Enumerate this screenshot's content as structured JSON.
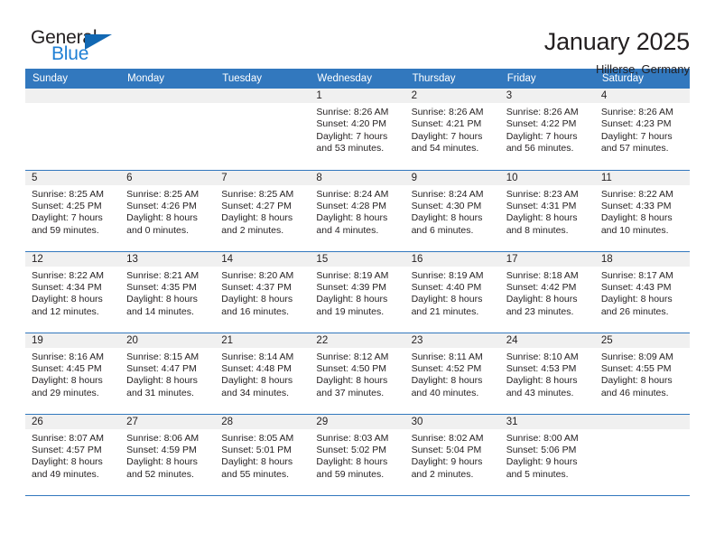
{
  "logo": {
    "word1": "General",
    "word2": "Blue",
    "triangle_color": "#1268b3",
    "blue_color": "#1f7fd4"
  },
  "header": {
    "title": "January 2025",
    "subtitle": "Hillerse, Germany"
  },
  "theme": {
    "header_blue": "#3278be",
    "daynum_band": "#f0f0f0",
    "text": "#231f20"
  },
  "weekdays": [
    "Sunday",
    "Monday",
    "Tuesday",
    "Wednesday",
    "Thursday",
    "Friday",
    "Saturday"
  ],
  "labels": {
    "sunrise_prefix": "Sunrise:",
    "sunset_prefix": "Sunset:",
    "daylight_prefix": "Daylight:"
  },
  "weeks": [
    [
      {
        "day": "",
        "empty": true
      },
      {
        "day": "",
        "empty": true
      },
      {
        "day": "",
        "empty": true
      },
      {
        "day": "1",
        "sunrise": "Sunrise: 8:26 AM",
        "sunset": "Sunset: 4:20 PM",
        "daylight1": "Daylight: 7 hours",
        "daylight2": "and 53 minutes."
      },
      {
        "day": "2",
        "sunrise": "Sunrise: 8:26 AM",
        "sunset": "Sunset: 4:21 PM",
        "daylight1": "Daylight: 7 hours",
        "daylight2": "and 54 minutes."
      },
      {
        "day": "3",
        "sunrise": "Sunrise: 8:26 AM",
        "sunset": "Sunset: 4:22 PM",
        "daylight1": "Daylight: 7 hours",
        "daylight2": "and 56 minutes."
      },
      {
        "day": "4",
        "sunrise": "Sunrise: 8:26 AM",
        "sunset": "Sunset: 4:23 PM",
        "daylight1": "Daylight: 7 hours",
        "daylight2": "and 57 minutes."
      }
    ],
    [
      {
        "day": "5",
        "sunrise": "Sunrise: 8:25 AM",
        "sunset": "Sunset: 4:25 PM",
        "daylight1": "Daylight: 7 hours",
        "daylight2": "and 59 minutes."
      },
      {
        "day": "6",
        "sunrise": "Sunrise: 8:25 AM",
        "sunset": "Sunset: 4:26 PM",
        "daylight1": "Daylight: 8 hours",
        "daylight2": "and 0 minutes."
      },
      {
        "day": "7",
        "sunrise": "Sunrise: 8:25 AM",
        "sunset": "Sunset: 4:27 PM",
        "daylight1": "Daylight: 8 hours",
        "daylight2": "and 2 minutes."
      },
      {
        "day": "8",
        "sunrise": "Sunrise: 8:24 AM",
        "sunset": "Sunset: 4:28 PM",
        "daylight1": "Daylight: 8 hours",
        "daylight2": "and 4 minutes."
      },
      {
        "day": "9",
        "sunrise": "Sunrise: 8:24 AM",
        "sunset": "Sunset: 4:30 PM",
        "daylight1": "Daylight: 8 hours",
        "daylight2": "and 6 minutes."
      },
      {
        "day": "10",
        "sunrise": "Sunrise: 8:23 AM",
        "sunset": "Sunset: 4:31 PM",
        "daylight1": "Daylight: 8 hours",
        "daylight2": "and 8 minutes."
      },
      {
        "day": "11",
        "sunrise": "Sunrise: 8:22 AM",
        "sunset": "Sunset: 4:33 PM",
        "daylight1": "Daylight: 8 hours",
        "daylight2": "and 10 minutes."
      }
    ],
    [
      {
        "day": "12",
        "sunrise": "Sunrise: 8:22 AM",
        "sunset": "Sunset: 4:34 PM",
        "daylight1": "Daylight: 8 hours",
        "daylight2": "and 12 minutes."
      },
      {
        "day": "13",
        "sunrise": "Sunrise: 8:21 AM",
        "sunset": "Sunset: 4:35 PM",
        "daylight1": "Daylight: 8 hours",
        "daylight2": "and 14 minutes."
      },
      {
        "day": "14",
        "sunrise": "Sunrise: 8:20 AM",
        "sunset": "Sunset: 4:37 PM",
        "daylight1": "Daylight: 8 hours",
        "daylight2": "and 16 minutes."
      },
      {
        "day": "15",
        "sunrise": "Sunrise: 8:19 AM",
        "sunset": "Sunset: 4:39 PM",
        "daylight1": "Daylight: 8 hours",
        "daylight2": "and 19 minutes."
      },
      {
        "day": "16",
        "sunrise": "Sunrise: 8:19 AM",
        "sunset": "Sunset: 4:40 PM",
        "daylight1": "Daylight: 8 hours",
        "daylight2": "and 21 minutes."
      },
      {
        "day": "17",
        "sunrise": "Sunrise: 8:18 AM",
        "sunset": "Sunset: 4:42 PM",
        "daylight1": "Daylight: 8 hours",
        "daylight2": "and 23 minutes."
      },
      {
        "day": "18",
        "sunrise": "Sunrise: 8:17 AM",
        "sunset": "Sunset: 4:43 PM",
        "daylight1": "Daylight: 8 hours",
        "daylight2": "and 26 minutes."
      }
    ],
    [
      {
        "day": "19",
        "sunrise": "Sunrise: 8:16 AM",
        "sunset": "Sunset: 4:45 PM",
        "daylight1": "Daylight: 8 hours",
        "daylight2": "and 29 minutes."
      },
      {
        "day": "20",
        "sunrise": "Sunrise: 8:15 AM",
        "sunset": "Sunset: 4:47 PM",
        "daylight1": "Daylight: 8 hours",
        "daylight2": "and 31 minutes."
      },
      {
        "day": "21",
        "sunrise": "Sunrise: 8:14 AM",
        "sunset": "Sunset: 4:48 PM",
        "daylight1": "Daylight: 8 hours",
        "daylight2": "and 34 minutes."
      },
      {
        "day": "22",
        "sunrise": "Sunrise: 8:12 AM",
        "sunset": "Sunset: 4:50 PM",
        "daylight1": "Daylight: 8 hours",
        "daylight2": "and 37 minutes."
      },
      {
        "day": "23",
        "sunrise": "Sunrise: 8:11 AM",
        "sunset": "Sunset: 4:52 PM",
        "daylight1": "Daylight: 8 hours",
        "daylight2": "and 40 minutes."
      },
      {
        "day": "24",
        "sunrise": "Sunrise: 8:10 AM",
        "sunset": "Sunset: 4:53 PM",
        "daylight1": "Daylight: 8 hours",
        "daylight2": "and 43 minutes."
      },
      {
        "day": "25",
        "sunrise": "Sunrise: 8:09 AM",
        "sunset": "Sunset: 4:55 PM",
        "daylight1": "Daylight: 8 hours",
        "daylight2": "and 46 minutes."
      }
    ],
    [
      {
        "day": "26",
        "sunrise": "Sunrise: 8:07 AM",
        "sunset": "Sunset: 4:57 PM",
        "daylight1": "Daylight: 8 hours",
        "daylight2": "and 49 minutes."
      },
      {
        "day": "27",
        "sunrise": "Sunrise: 8:06 AM",
        "sunset": "Sunset: 4:59 PM",
        "daylight1": "Daylight: 8 hours",
        "daylight2": "and 52 minutes."
      },
      {
        "day": "28",
        "sunrise": "Sunrise: 8:05 AM",
        "sunset": "Sunset: 5:01 PM",
        "daylight1": "Daylight: 8 hours",
        "daylight2": "and 55 minutes."
      },
      {
        "day": "29",
        "sunrise": "Sunrise: 8:03 AM",
        "sunset": "Sunset: 5:02 PM",
        "daylight1": "Daylight: 8 hours",
        "daylight2": "and 59 minutes."
      },
      {
        "day": "30",
        "sunrise": "Sunrise: 8:02 AM",
        "sunset": "Sunset: 5:04 PM",
        "daylight1": "Daylight: 9 hours",
        "daylight2": "and 2 minutes."
      },
      {
        "day": "31",
        "sunrise": "Sunrise: 8:00 AM",
        "sunset": "Sunset: 5:06 PM",
        "daylight1": "Daylight: 9 hours",
        "daylight2": "and 5 minutes."
      },
      {
        "day": "",
        "empty": true
      }
    ]
  ]
}
